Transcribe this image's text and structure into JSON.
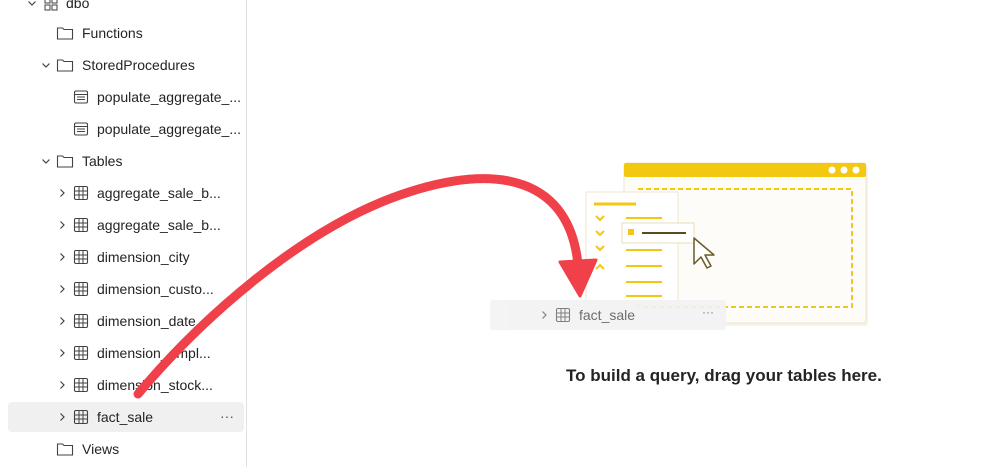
{
  "tree": {
    "schema_label": "dbo",
    "items": [
      {
        "label": "Functions",
        "type": "folder"
      },
      {
        "label": "StoredProcedures",
        "type": "folder"
      },
      {
        "label": "populate_aggregate_...",
        "type": "procedure"
      },
      {
        "label": "populate_aggregate_...",
        "type": "procedure"
      },
      {
        "label": "Tables",
        "type": "folder"
      },
      {
        "label": "aggregate_sale_b...",
        "type": "table"
      },
      {
        "label": "aggregate_sale_b...",
        "type": "table"
      },
      {
        "label": "dimension_city",
        "type": "table"
      },
      {
        "label": "dimension_custo...",
        "type": "table"
      },
      {
        "label": "dimension_date",
        "type": "table"
      },
      {
        "label": "dimension_empl...",
        "type": "table"
      },
      {
        "label": "dimension_stock...",
        "type": "table"
      },
      {
        "label": "fact_sale",
        "type": "table"
      },
      {
        "label": "Views",
        "type": "folder"
      }
    ],
    "more_label": "···"
  },
  "canvas": {
    "drag_item_label": "fact_sale",
    "drag_item_more": "···",
    "empty_message": "To build a query, drag your tables here."
  },
  "colors": {
    "arrow": "#f0404a",
    "accent_yellow": "#f2c811",
    "selected_row": "#f0f0f0"
  }
}
